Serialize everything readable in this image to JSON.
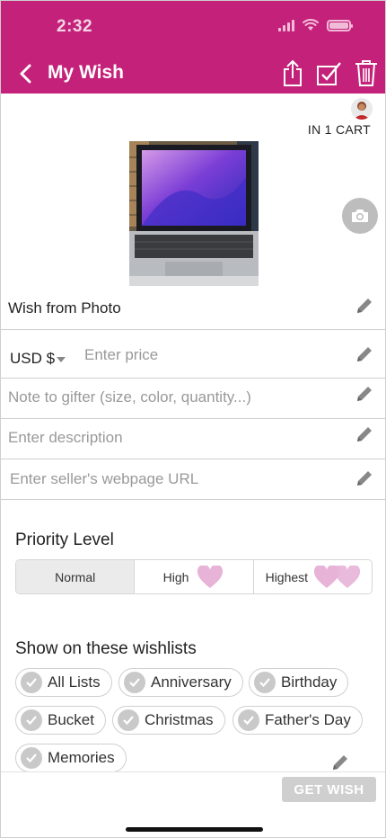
{
  "status_bar": {
    "time": "2:32"
  },
  "nav": {
    "title": "My Wish"
  },
  "cart": {
    "label": "IN 1 CART"
  },
  "form": {
    "wish_name": "Wish from Photo",
    "currency": "USD $",
    "price_placeholder": "Enter price",
    "note_placeholder": "Note to gifter (size, color, quantity...)",
    "description_placeholder": "Enter description",
    "url_placeholder": "Enter seller's webpage URL"
  },
  "priority": {
    "title": "Priority Level",
    "options": [
      "Normal",
      "High",
      "Highest"
    ],
    "selected": "Normal"
  },
  "wishlists": {
    "title": "Show on these wishlists",
    "items": [
      "All Lists",
      "Anniversary",
      "Birthday",
      "Bucket",
      "Christmas",
      "Father's Day",
      "Memories"
    ]
  },
  "actions": {
    "get_wish": "GET WISH"
  },
  "colors": {
    "brand": "#c4217a",
    "heart": "#e7b3d7"
  }
}
